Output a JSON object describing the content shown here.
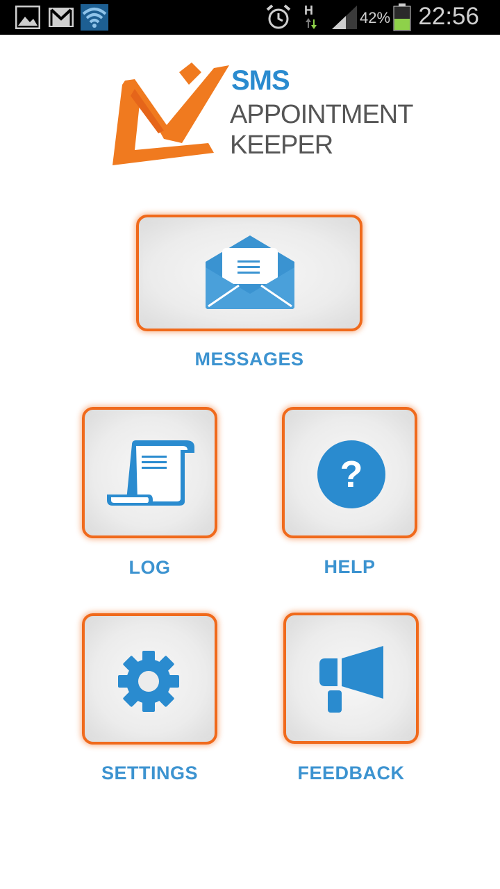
{
  "status_bar": {
    "battery_percent": "42%",
    "time": "22:56",
    "network_type": "H",
    "icons": [
      "gallery-icon",
      "gmail-icon",
      "wifi-icon",
      "alarm-icon",
      "data-arrows-icon",
      "signal-icon",
      "battery-icon"
    ]
  },
  "logo": {
    "line1": "SMS",
    "line2": "APPOINTMENT",
    "line3": "KEEPER"
  },
  "menu": {
    "messages_label": "MESSAGES",
    "log_label": "LOG",
    "help_label": "HELP",
    "settings_label": "SETTINGS",
    "feedback_label": "FEEDBACK"
  },
  "colors": {
    "accent_orange": "#f06a1c",
    "icon_blue": "#2a8bcf",
    "label_blue": "#3c93d0",
    "logo_gray": "#555555"
  }
}
